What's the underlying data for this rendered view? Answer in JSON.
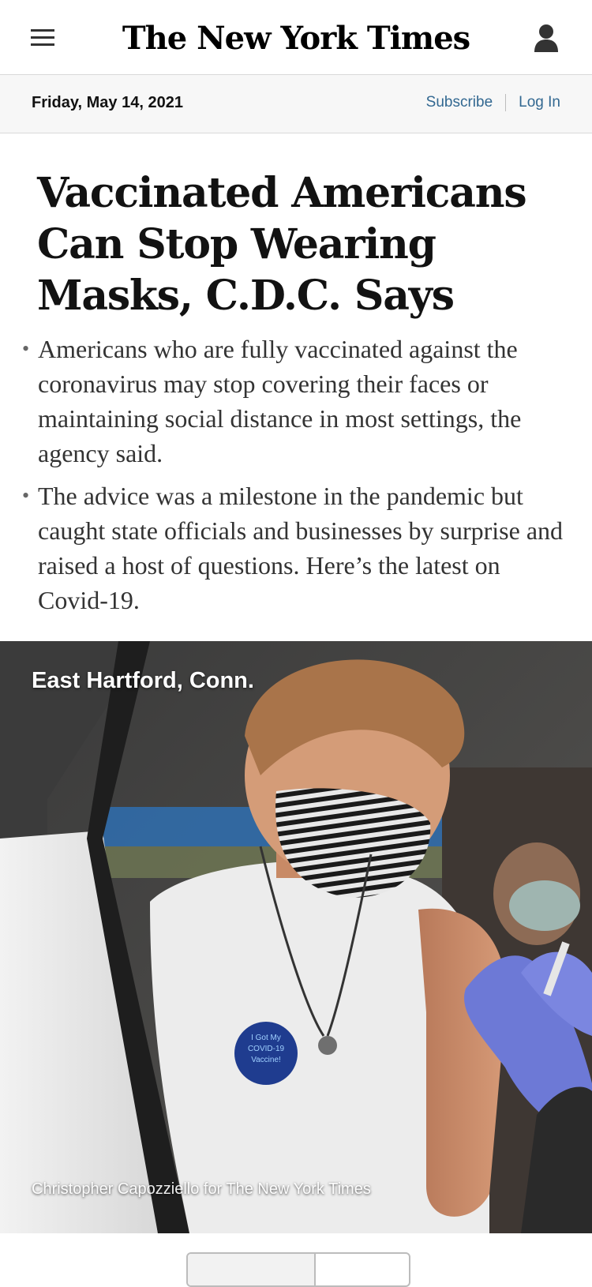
{
  "masthead": {
    "logo_text": "The New York Times",
    "menu_icon": "hamburger-menu-icon",
    "account_icon": "user-account-icon"
  },
  "datebar": {
    "date": "Friday, May 14, 2021",
    "subscribe_label": "Subscribe",
    "login_label": "Log In"
  },
  "story": {
    "headline": "Vaccinated Americans Can Stop Wearing Masks, C.D.C. Says",
    "summary": [
      "Americans who are fully vaccinated against the coronavirus may stop covering their faces or maintaining social distance in most settings, the agency said.",
      "The advice was a milestone in the pandemic but caught state officials and businesses by surprise and raised a host of questions. Here’s the latest on Covid-19."
    ]
  },
  "photo": {
    "dateline": "East Hartford, Conn.",
    "credit": "Christopher Capozziello for The New York Times",
    "badge_text": "I Got My COVID-19 Vaccine!"
  },
  "colors": {
    "link": "#326891",
    "headline": "#121212",
    "summary": "#333333",
    "datebar_bg": "#f7f7f7"
  }
}
